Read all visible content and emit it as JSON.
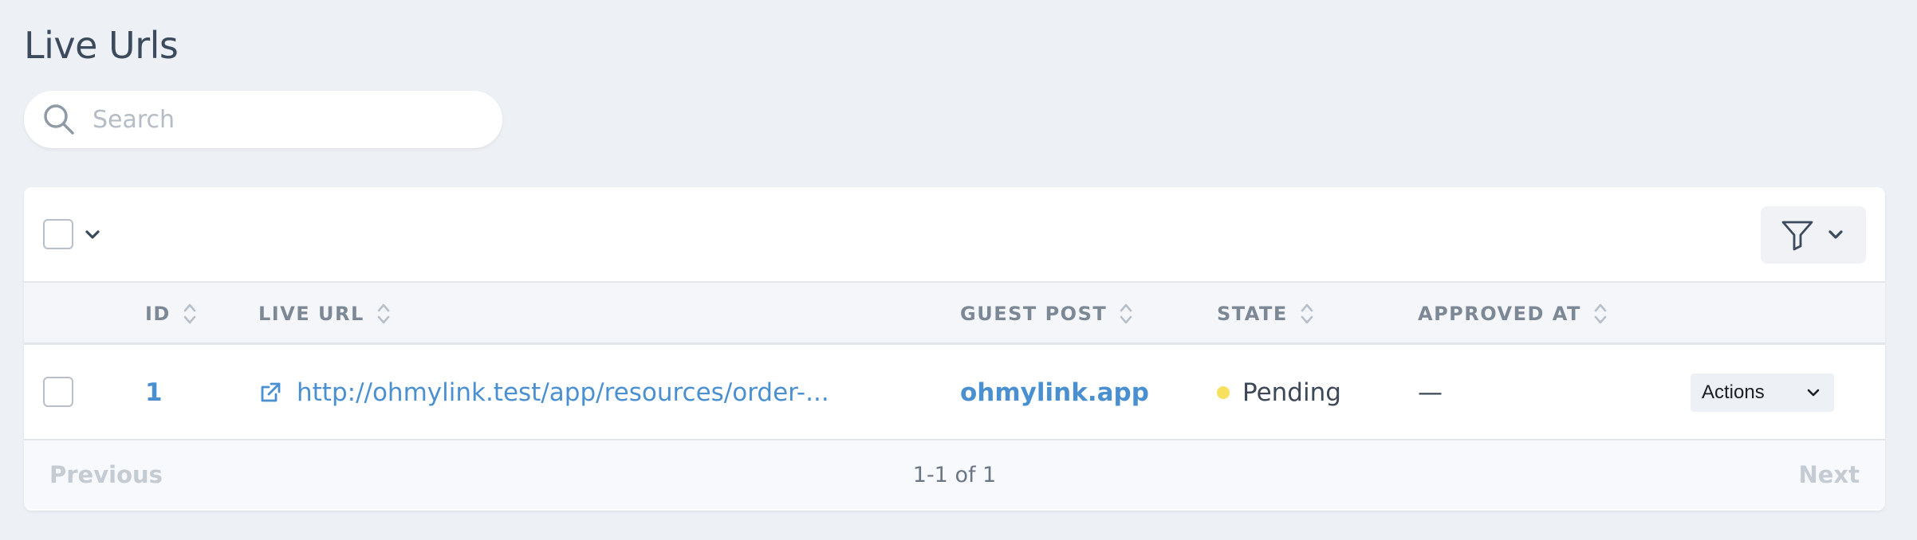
{
  "page": {
    "title": "Live Urls"
  },
  "search": {
    "placeholder": "Search",
    "value": "",
    "icon": "search-icon"
  },
  "toolbar": {
    "select_all_icon": "chevron-down-icon",
    "filter_icon": "filter-icon"
  },
  "table": {
    "columns": [
      {
        "key": "id",
        "label": "ID",
        "sortable": true
      },
      {
        "key": "live_url",
        "label": "LIVE URL",
        "sortable": true
      },
      {
        "key": "guest_post",
        "label": "GUEST POST",
        "sortable": true
      },
      {
        "key": "state",
        "label": "STATE",
        "sortable": true
      },
      {
        "key": "approved_at",
        "label": "APPROVED AT",
        "sortable": true
      }
    ],
    "rows": [
      {
        "id": "1",
        "live_url": "http://ohmylink.test/app/resources/order-...",
        "guest_post": "ohmylink.app",
        "state": "Pending",
        "state_color": "#f6e05e",
        "approved_at": "—",
        "actions_label": "Actions"
      }
    ]
  },
  "pagination": {
    "previous": "Previous",
    "summary": "1-1 of 1",
    "next": "Next"
  },
  "colors": {
    "link": "#4a90d0",
    "background": "#edf0f4",
    "pending": "#f6e05e"
  }
}
